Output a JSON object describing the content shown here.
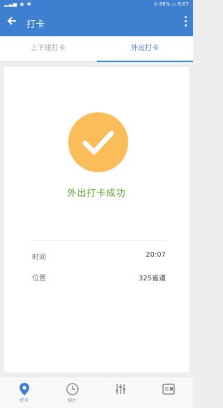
{
  "statusbar": {
    "left_icons": "signal wifi",
    "battery": "66%",
    "time": "8:07"
  },
  "appbar": {
    "title": "打卡"
  },
  "tabs": [
    {
      "label": "上下班打卡",
      "active": false
    },
    {
      "label": "外出打卡",
      "active": true
    }
  ],
  "result": {
    "message": "外出打卡成功",
    "icon": "check-icon"
  },
  "details": {
    "time_label": "时间",
    "time_value": "20:07",
    "location_label": "位置",
    "location_value": "325省道"
  },
  "bottom_nav": [
    {
      "label": "打卡",
      "icon": "location-pin-icon",
      "active": true
    },
    {
      "label": "统计",
      "icon": "clock-icon",
      "active": false
    },
    {
      "label": "",
      "icon": "sliders-icon",
      "active": false
    },
    {
      "label": "",
      "icon": "id-card-icon",
      "active": false
    }
  ],
  "colors": {
    "primary": "#3f7fcf",
    "success_circle": "#fbbc5a",
    "success_text": "#5b9e2c"
  }
}
